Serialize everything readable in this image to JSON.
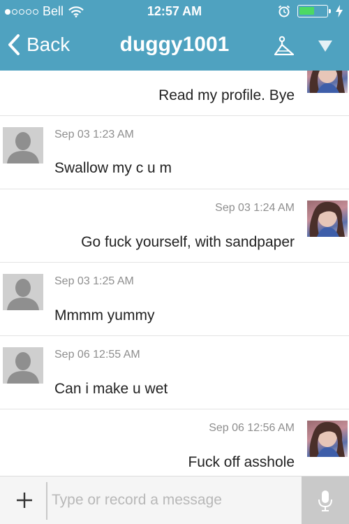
{
  "status_bar": {
    "carrier": "Bell",
    "time": "12:57 AM",
    "signal_bars_filled": 1,
    "signal_bars_total": 5,
    "battery_level": 0.55
  },
  "nav": {
    "back_label": "Back",
    "title": "duggy1001"
  },
  "messages": [
    {
      "direction": "outgoing",
      "timestamp": "",
      "text": "Read my profile. Bye"
    },
    {
      "direction": "incoming",
      "timestamp": "Sep 03 1:23 AM",
      "text": "Swallow my c u m"
    },
    {
      "direction": "outgoing",
      "timestamp": "Sep 03 1:24 AM",
      "text": "Go fuck yourself, with sandpaper"
    },
    {
      "direction": "incoming",
      "timestamp": "Sep 03 1:25 AM",
      "text": "Mmmm yummy"
    },
    {
      "direction": "incoming",
      "timestamp": "Sep 06 12:55 AM",
      "text": "Can i make u wet"
    },
    {
      "direction": "outgoing",
      "timestamp": "Sep 06 12:56 AM",
      "text": "Fuck off asshole"
    }
  ],
  "composer": {
    "placeholder": "Type or record a message"
  },
  "colors": {
    "nav_background": "#4fa2c0",
    "timestamp": "#8e8e8e",
    "battery_fill": "#4cd964"
  },
  "icons": [
    "wifi-icon",
    "alarm-icon",
    "battery-icon",
    "charging-icon",
    "back-chevron-icon",
    "hanger-icon",
    "dropdown-icon",
    "avatar-placeholder-icon",
    "plus-icon",
    "microphone-icon"
  ]
}
